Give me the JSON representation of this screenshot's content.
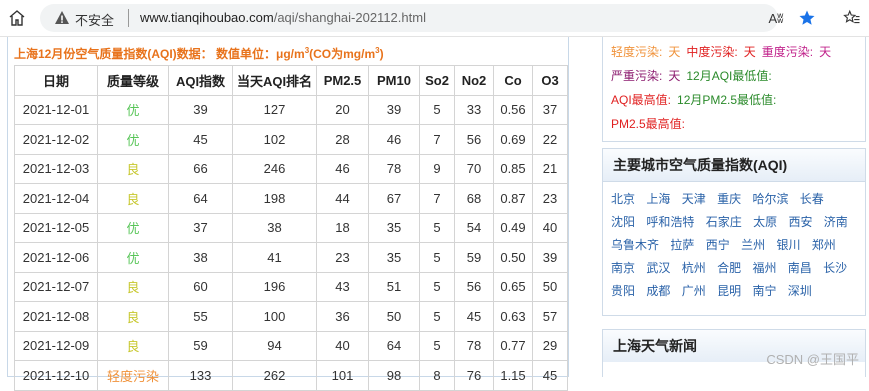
{
  "browser": {
    "insecure_label": "不安全",
    "url_host": "www.tianqihoubao.com",
    "url_path": "/aqi/shanghai-202112.html",
    "read_aloud_label": "Aʬ"
  },
  "table": {
    "caption_main": "上海12月份空气质量指数(AQI)数据：  数值单位：μg/m",
    "caption_sup1": "3",
    "caption_mid": "(CO为mg/m",
    "caption_sup2": "3",
    "caption_end": ")",
    "headers": [
      "日期",
      "质量等级",
      "AQI指数",
      "当天AQI排名",
      "PM2.5",
      "PM10",
      "So2",
      "No2",
      "Co",
      "O3"
    ],
    "rows": [
      {
        "date": "2021-12-01",
        "level": "优",
        "level_color": "#58c558",
        "aqi": "39",
        "rank": "127",
        "pm25": "20",
        "pm10": "39",
        "so2": "5",
        "no2": "33",
        "co": "0.56",
        "o3": "37"
      },
      {
        "date": "2021-12-02",
        "level": "优",
        "level_color": "#58c558",
        "aqi": "45",
        "rank": "102",
        "pm25": "28",
        "pm10": "46",
        "so2": "7",
        "no2": "56",
        "co": "0.69",
        "o3": "22"
      },
      {
        "date": "2021-12-03",
        "level": "良",
        "level_color": "#c8c830",
        "aqi": "66",
        "rank": "246",
        "pm25": "46",
        "pm10": "78",
        "so2": "9",
        "no2": "70",
        "co": "0.85",
        "o3": "21"
      },
      {
        "date": "2021-12-04",
        "level": "良",
        "level_color": "#c8c830",
        "aqi": "64",
        "rank": "198",
        "pm25": "44",
        "pm10": "67",
        "so2": "7",
        "no2": "68",
        "co": "0.87",
        "o3": "23"
      },
      {
        "date": "2021-12-05",
        "level": "优",
        "level_color": "#58c558",
        "aqi": "37",
        "rank": "38",
        "pm25": "18",
        "pm10": "35",
        "so2": "5",
        "no2": "54",
        "co": "0.49",
        "o3": "40"
      },
      {
        "date": "2021-12-06",
        "level": "优",
        "level_color": "#58c558",
        "aqi": "38",
        "rank": "41",
        "pm25": "23",
        "pm10": "35",
        "so2": "5",
        "no2": "59",
        "co": "0.50",
        "o3": "39"
      },
      {
        "date": "2021-12-07",
        "level": "良",
        "level_color": "#c8c830",
        "aqi": "60",
        "rank": "196",
        "pm25": "43",
        "pm10": "51",
        "so2": "5",
        "no2": "56",
        "co": "0.65",
        "o3": "50"
      },
      {
        "date": "2021-12-08",
        "level": "良",
        "level_color": "#c8c830",
        "aqi": "55",
        "rank": "100",
        "pm25": "36",
        "pm10": "50",
        "so2": "5",
        "no2": "45",
        "co": "0.63",
        "o3": "57"
      },
      {
        "date": "2021-12-09",
        "level": "良",
        "level_color": "#c8c830",
        "aqi": "59",
        "rank": "94",
        "pm25": "40",
        "pm10": "64",
        "so2": "5",
        "no2": "78",
        "co": "0.77",
        "o3": "29"
      },
      {
        "date": "2021-12-10",
        "level": "轻度污染",
        "level_color": "#f0923a",
        "aqi": "133",
        "rank": "262",
        "pm25": "101",
        "pm10": "98",
        "so2": "8",
        "no2": "76",
        "co": "1.15",
        "o3": "45"
      }
    ]
  },
  "legend": {
    "line1": [
      {
        "text": "轻度污染:",
        "color": "#f0923a"
      },
      {
        "text": "天",
        "color": "#f0923a"
      },
      {
        "text": "中度污染:",
        "color": "#e02020"
      },
      {
        "text": "天",
        "color": "#e02020"
      },
      {
        "text": "重度污染:",
        "color": "#c0208a"
      },
      {
        "text": "天",
        "color": "#c0208a"
      }
    ],
    "line2": [
      {
        "text": "严重污染:",
        "color": "#8b1a6e"
      },
      {
        "text": "天",
        "color": "#8b1a6e"
      },
      {
        "text": "12月AQI最低值:",
        "color": "#2a8a2a"
      }
    ],
    "line3": [
      {
        "text": "AQI最高值:",
        "color": "#e02020"
      },
      {
        "text": "12月PM2.5最低值:",
        "color": "#2a8a2a"
      }
    ],
    "line4": [
      {
        "text": "PM2.5最高值:",
        "color": "#e02020"
      }
    ]
  },
  "cities_box": {
    "title": "主要城市空气质量指数(AQI)",
    "cities": [
      "北京",
      "上海",
      "天津",
      "重庆",
      "哈尔滨",
      "长春",
      "沈阳",
      "呼和浩特",
      "石家庄",
      "太原",
      "西安",
      "济南",
      "乌鲁木齐",
      "拉萨",
      "西宁",
      "兰州",
      "银川",
      "郑州",
      "南京",
      "武汉",
      "杭州",
      "合肥",
      "福州",
      "南昌",
      "长沙",
      "贵阳",
      "成都",
      "广州",
      "昆明",
      "南宁",
      "深圳"
    ]
  },
  "news_box": {
    "title": "上海天气新闻"
  },
  "watermark": "CSDN @王国平"
}
